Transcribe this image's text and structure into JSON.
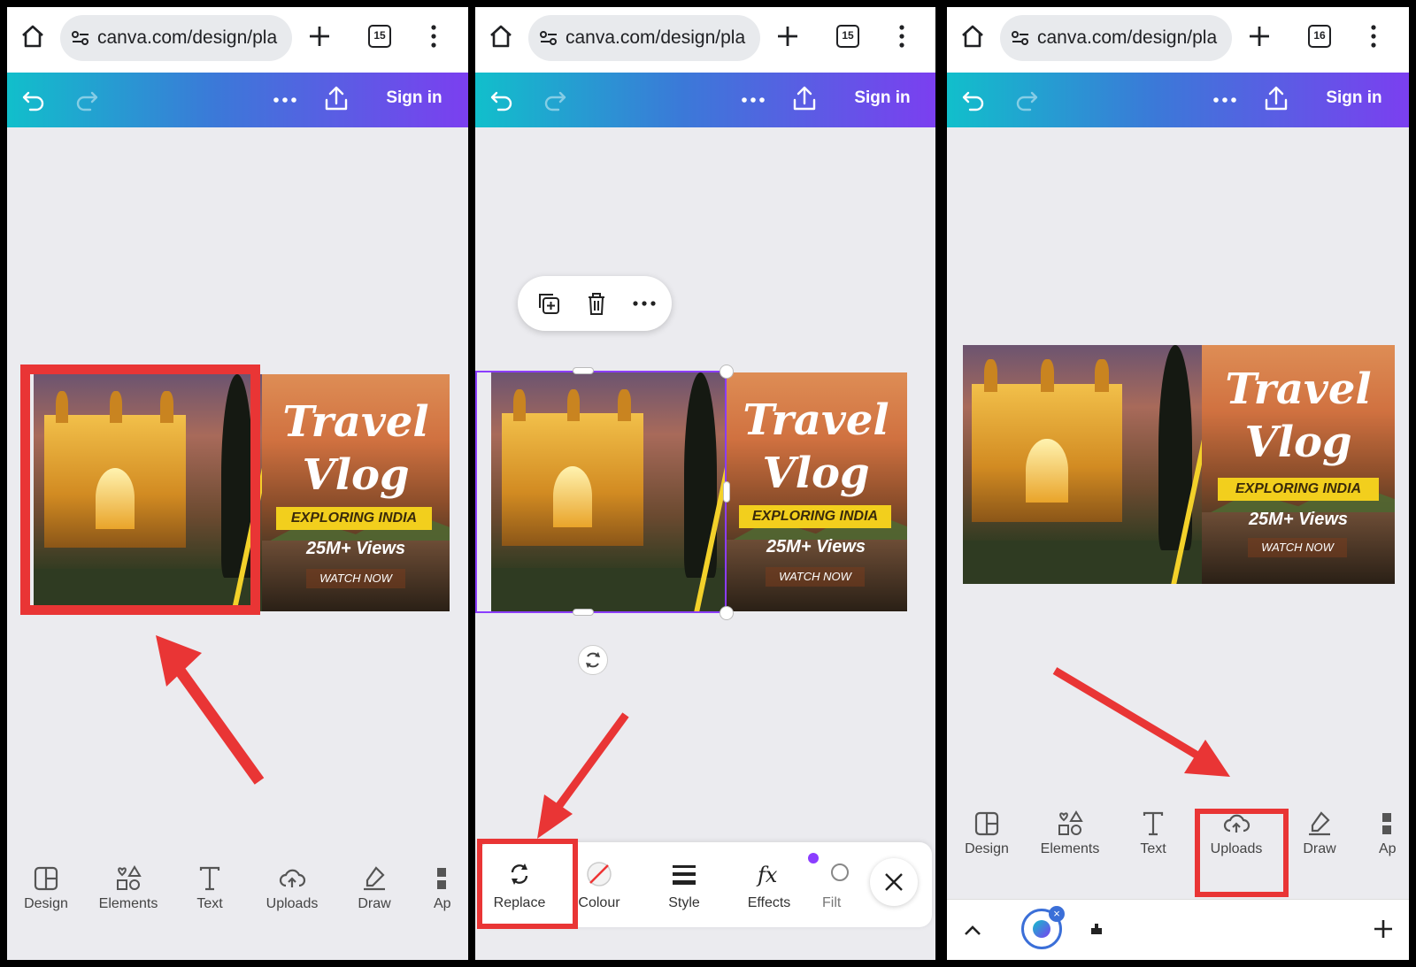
{
  "browser": {
    "url": "canva.com/design/pla",
    "panels_tab_count": [
      "15",
      "15",
      "16"
    ]
  },
  "header": {
    "signin_label": "Sign in"
  },
  "design": {
    "title_line1": "Travel",
    "title_line2": "Vlog",
    "banner": "EXPLORING INDIA",
    "views": "25M+ Views",
    "cta": "WATCH NOW"
  },
  "bottom_nav": {
    "design": "Design",
    "elements": "Elements",
    "text": "Text",
    "uploads": "Uploads",
    "draw": "Draw",
    "apps": "Ap"
  },
  "edit_toolbar": {
    "replace": "Replace",
    "colour": "Colour",
    "style": "Style",
    "effects": "Effects",
    "filter": "Filt"
  },
  "colors": {
    "highlight": "#e93535",
    "selection": "#8b3dff",
    "header_gradient": [
      "#11bfcb",
      "#3b79d8",
      "#7b3ff0"
    ]
  }
}
